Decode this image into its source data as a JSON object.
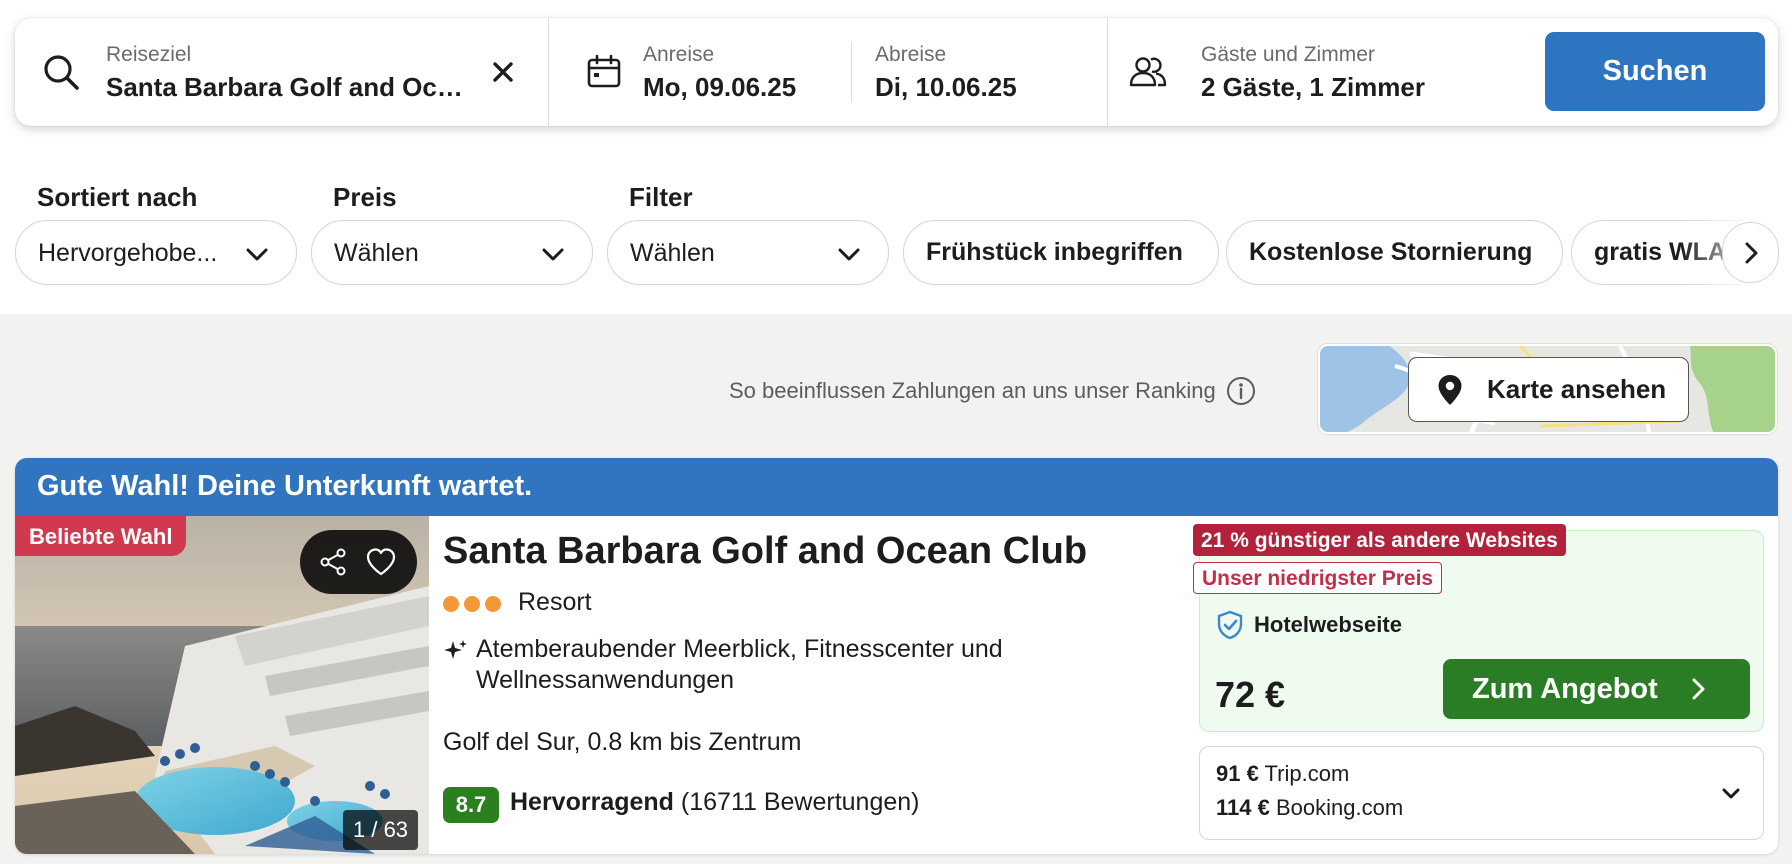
{
  "search": {
    "destination_label": "Reiseziel",
    "destination_value": "Santa Barbara Golf and Ocean Club",
    "checkin_label": "Anreise",
    "checkin_value": "Mo, 09.06.25",
    "checkout_label": "Abreise",
    "checkout_value": "Di, 10.06.25",
    "guests_label": "Gäste und Zimmer",
    "guests_value": "2 Gäste, 1 Zimmer",
    "search_button": "Suchen"
  },
  "filters": {
    "sort_label": "Sortiert nach",
    "sort_value": "Hervorgehobe...",
    "price_label": "Preis",
    "price_value": "Wählen",
    "filter_label": "Filter",
    "filter_value": "Wählen",
    "chips": [
      "Frühstück inbegriffen",
      "Kostenlose Stornierung",
      "gratis WLAN"
    ]
  },
  "ranking_note": "So beeinflussen Zahlungen an uns unser Ranking",
  "map_button": "Karte ansehen",
  "result": {
    "banner": "Gute Wahl! Deine Unterkunft wartet.",
    "popular_badge": "Beliebte Wahl",
    "photo_counter": "1 / 63",
    "name": "Santa Barbara Golf and Ocean Club",
    "star_count": 3,
    "type": "Resort",
    "highlights": "Atemberaubender Meerblick, Fitnesscenter und Wellnessanwendungen",
    "location": "Golf del Sur, 0.8 km bis Zentrum",
    "rating_score": "8.7",
    "rating_label": "Hervorragend",
    "rating_count": "(16711 Bewertungen)",
    "deal": {
      "cheaper_badge": "21 % günstiger als andere Websites",
      "lowest_badge": "Unser niedrigster Preis",
      "provider": "Hotelwebseite",
      "price": "72 €",
      "offer_button": "Zum Angebot"
    },
    "alternatives": [
      {
        "price": "91 €",
        "site": "Trip.com"
      },
      {
        "price": "114 €",
        "site": "Booking.com"
      }
    ]
  },
  "colors": {
    "primary_blue": "#2d74c1",
    "banner_blue": "#3174bf",
    "offer_green": "#2b7d25",
    "rating_green": "#2a7f1e",
    "badge_red": "#b3213a",
    "popular_red": "#d13a4e",
    "star_orange": "#f29837"
  }
}
